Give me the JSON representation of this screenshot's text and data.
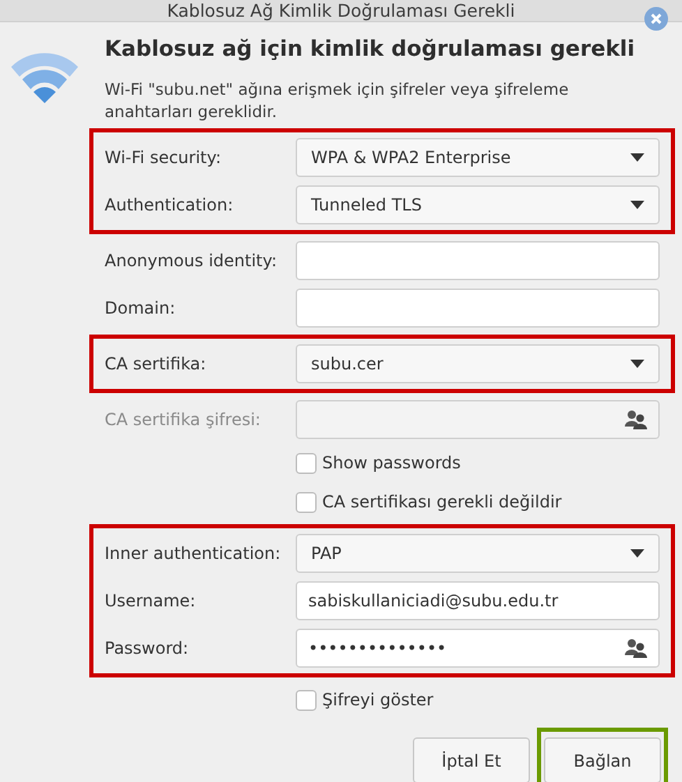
{
  "window": {
    "title": "Kablosuz Ağ Kimlik Doğrulaması Gerekli"
  },
  "heading": "Kablosuz ağ için kimlik doğrulaması gerekli",
  "description": "Wi-Fi \"subu.net\" ağına erişmek için şifreler veya şifreleme anahtarları gereklidir.",
  "groups": [
    {
      "highlighted": true,
      "rows": [
        {
          "kind": "dropdown",
          "label": "Wi-Fi security:",
          "value": "WPA & WPA2 Enterprise",
          "disabled": false
        },
        {
          "kind": "dropdown",
          "label": "Authentication:",
          "value": "Tunneled TLS",
          "disabled": false
        }
      ]
    },
    {
      "highlighted": false,
      "rows": [
        {
          "kind": "entry",
          "label": "Anonymous identity:",
          "disabled": false
        },
        {
          "kind": "entry",
          "label": "Domain:",
          "disabled": false
        }
      ]
    },
    {
      "highlighted": true,
      "rows": [
        {
          "kind": "dropdown",
          "label": "CA sertifika:",
          "value": "subu.cer",
          "disabled": false
        }
      ]
    },
    {
      "highlighted": false,
      "rows": [
        {
          "kind": "password",
          "label": "CA sertifika şifresi:",
          "disabled": true
        },
        {
          "kind": "checkbox",
          "label": "Show passwords",
          "checked": false,
          "disabled": false
        },
        {
          "kind": "checkbox",
          "label": "CA sertifikası gerekli değildir",
          "checked": false,
          "disabled": false
        }
      ]
    },
    {
      "highlighted": true,
      "rows": [
        {
          "kind": "dropdown",
          "label": "Inner authentication:",
          "value": "PAP",
          "disabled": false
        },
        {
          "kind": "entry",
          "label": "Username:",
          "value": "sabiskullaniciadi@subu.edu.tr",
          "disabled": false
        },
        {
          "kind": "password",
          "label": "Password:",
          "value": "••••••••••••••",
          "disabled": false
        }
      ]
    },
    {
      "highlighted": false,
      "rows": [
        {
          "kind": "checkbox",
          "label": "Şifreyi göster",
          "checked": false,
          "disabled": false
        }
      ]
    }
  ],
  "buttons": [
    {
      "label": "İptal Et",
      "highlighted": false
    },
    {
      "label": "Bağlan",
      "highlighted": true
    }
  ]
}
